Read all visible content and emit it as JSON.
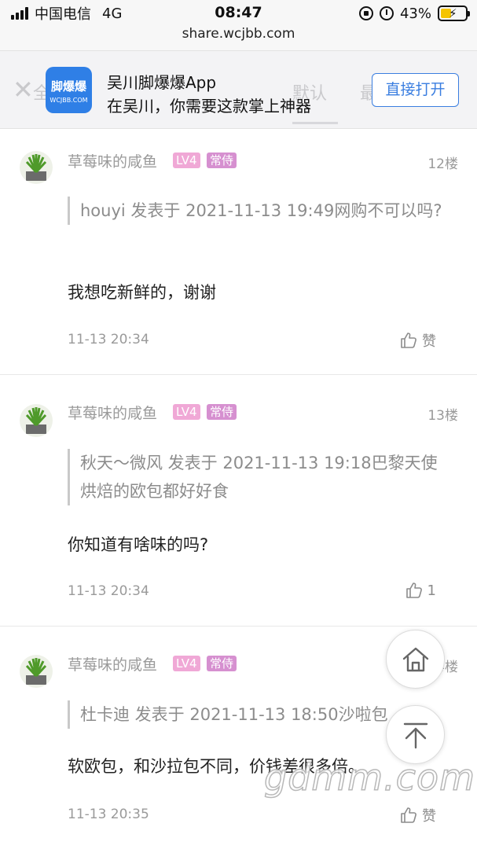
{
  "status_bar": {
    "carrier": "中国电信",
    "network": "4G",
    "time": "08:47",
    "battery": "43%",
    "url": "share.wcjbb.com"
  },
  "banner": {
    "logo_main": "脚爆爆",
    "logo_sub": "WCJBB.COM",
    "app_name": "吴川脚爆爆App",
    "app_desc": "在吴川，你需要这款掌上神器",
    "open_button": "直接打开",
    "background_tabs": [
      "全",
      "默认",
      "最新"
    ]
  },
  "comments": [
    {
      "user": "草莓味的咸鱼",
      "level": "LV4",
      "role": "常侍",
      "floor": "12楼",
      "quote": "houyi 发表于 2021-11-13 19:49网购不可以吗?",
      "text": "我想吃新鲜的，谢谢",
      "time": "11-13 20:34",
      "like": "赞"
    },
    {
      "user": "草莓味的咸鱼",
      "level": "LV4",
      "role": "常侍",
      "floor": "13楼",
      "quote": "秋天～微风 发表于 2021-11-13 19:18巴黎天使烘焙的欧包都好好食",
      "text": "你知道有啥味的吗?",
      "time": "11-13 20:34",
      "like": "1"
    },
    {
      "user": "草莓味的咸鱼",
      "level": "LV4",
      "role": "常侍",
      "floor": "14楼",
      "quote": "杜卡迪 发表于 2021-11-13 18:50沙啦包",
      "text": "软欧包，和沙拉包不同，价钱差很多倍。",
      "time": "11-13 20:35",
      "like": "赞"
    }
  ],
  "watermark": "gdmm.com",
  "colors": {
    "accent_blue": "#3a7ee0",
    "badge_level": "#f0a8d6",
    "badge_role": "#d690d0"
  },
  "icons": [
    "lock-rotation-icon",
    "alarm-icon",
    "battery-charging-icon",
    "close-icon",
    "thumb-up-icon",
    "home-icon",
    "back-to-top-icon"
  ]
}
